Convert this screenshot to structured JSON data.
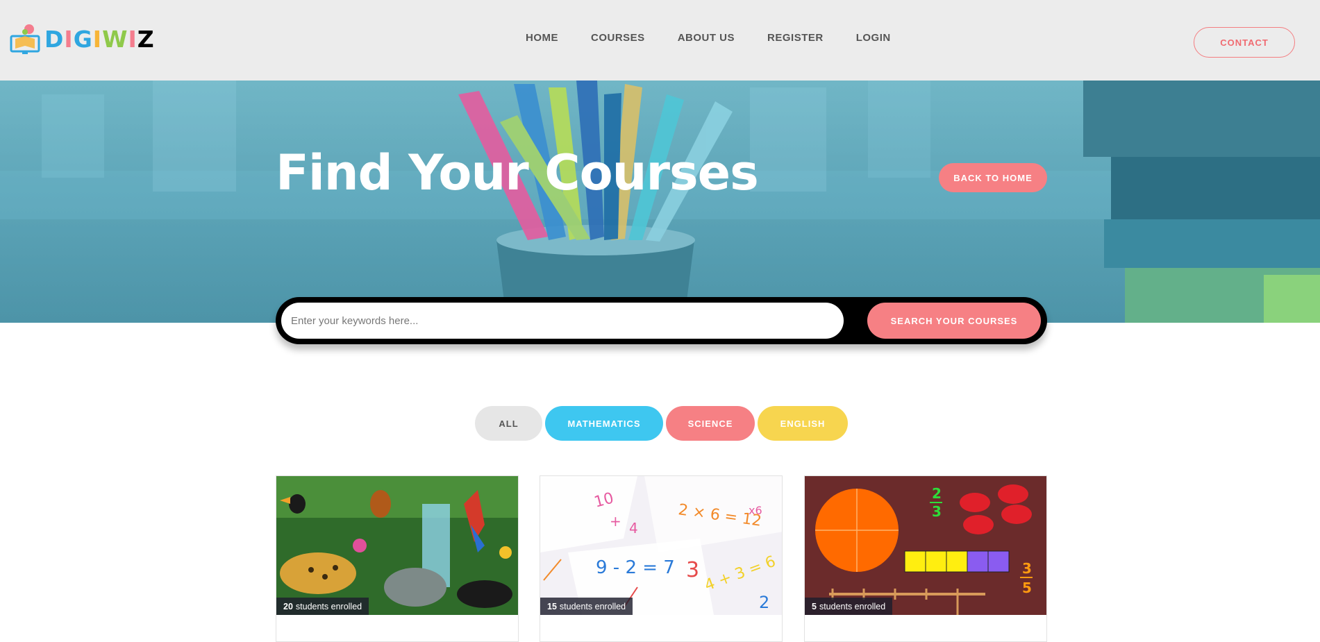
{
  "brand": {
    "logo_text": [
      "D",
      "I",
      "G",
      "I",
      "W",
      "I",
      "Z"
    ]
  },
  "nav": {
    "items": [
      "HOME",
      "COURSES",
      "ABOUT US",
      "REGISTER",
      "LOGIN"
    ],
    "contact_label": "CONTACT"
  },
  "hero": {
    "title": "Find Your Courses",
    "back_label": "BACK TO HOME"
  },
  "search": {
    "placeholder": "Enter your keywords here...",
    "button_label": "SEARCH YOUR COURSES"
  },
  "filters": [
    {
      "label": "ALL"
    },
    {
      "label": "MATHEMATICS"
    },
    {
      "label": "SCIENCE"
    },
    {
      "label": "ENGLISH"
    }
  ],
  "courses": [
    {
      "enrolled_count": "20",
      "enrolled_suffix": "students enrolled"
    },
    {
      "enrolled_count": "15",
      "enrolled_suffix": "students enrolled"
    },
    {
      "enrolled_count": "5",
      "enrolled_suffix": "students enrolled"
    }
  ],
  "card_image_text": {
    "math_card": [
      "10",
      "+",
      "4",
      "2 × 6 = 12",
      "9 - 2 = 7",
      "3",
      "4 + 3 = 6",
      "2",
      "x6"
    ],
    "fraction_card": [
      "2",
      "3",
      "3",
      "5"
    ]
  },
  "colors": {
    "accent_pink": "#f68084",
    "math_blue": "#3ec7f0",
    "english_yellow": "#f7d54f",
    "header_bg": "#ececec"
  }
}
